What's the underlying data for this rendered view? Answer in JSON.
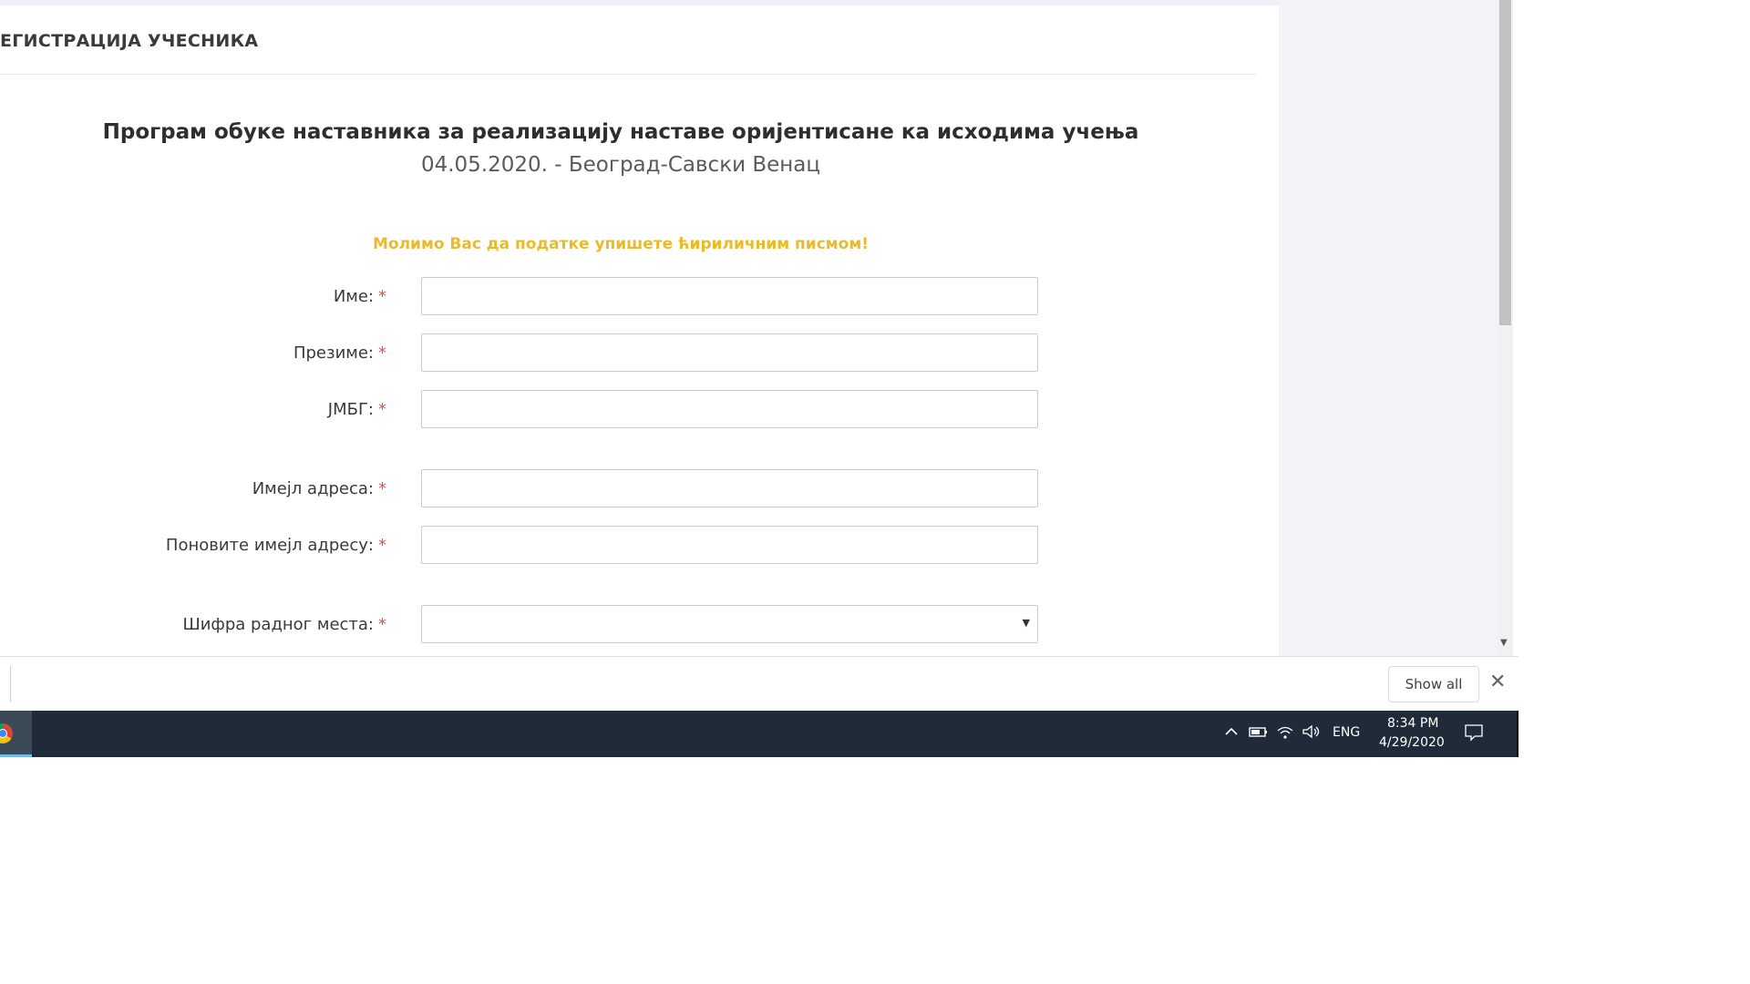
{
  "page": {
    "card_title": "ЕГИСТРАЦИЈА УЧЕСНИКА",
    "event_title": "Програм обуке наставника за реализацију наставе оријентисане ка исходима учења",
    "event_subtitle": "04.05.2020. - Београд-Савски Венац",
    "notice": "Молимо Вас да податке упишете ћириличним писмом!",
    "required_mark": "*"
  },
  "form": {
    "fields": [
      {
        "label": "Име:",
        "value": "",
        "type": "text"
      },
      {
        "label": "Презиме:",
        "value": "",
        "type": "text"
      },
      {
        "label": "ЈМБГ:",
        "value": "",
        "type": "text"
      },
      {
        "label": "Имејл адреса:",
        "value": "",
        "type": "email"
      },
      {
        "label": "Поновите имејл адресу:",
        "value": "",
        "type": "email"
      },
      {
        "label": "Шифра радног места:",
        "value": "",
        "type": "select"
      }
    ]
  },
  "download_bar": {
    "show_all_label": "Show all",
    "close_glyph": "✕"
  },
  "taskbar": {
    "language": "ENG",
    "time": "8:34 PM",
    "date": "4/29/2020",
    "icons": [
      "chevron-up-icon",
      "battery-icon",
      "wifi-icon",
      "volume-icon",
      "notifications-icon"
    ]
  },
  "colors": {
    "notice": "#e9bb2a",
    "required": "#d9534f",
    "taskbar": "#1f2b38"
  }
}
